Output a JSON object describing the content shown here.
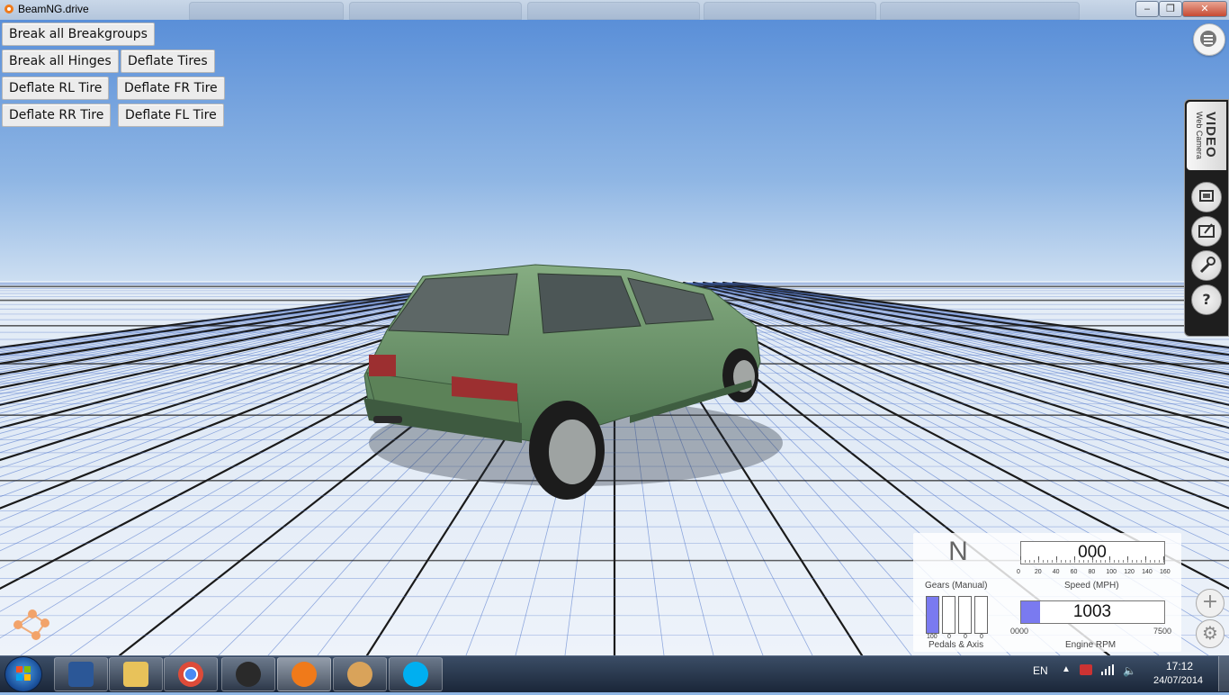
{
  "window": {
    "title": "BeamNG.drive",
    "controls": {
      "minimize": "‒",
      "restore": "❐",
      "close": "✕"
    }
  },
  "gamebuttons": {
    "break_all_breakgroups": "Break all Breakgroups",
    "break_all_hinges": "Break all Hinges",
    "deflate_tires": "Deflate Tires",
    "deflate_rl": "Deflate RL Tire",
    "deflate_fr": "Deflate FR Tire",
    "deflate_rr": "Deflate RR Tire",
    "deflate_fl": "Deflate FL Tire"
  },
  "video_panel": {
    "title": "VIDEO",
    "subtitle": "Web Camera",
    "icons": [
      "presentation-icon",
      "edit-icon",
      "wrench-icon",
      "help-icon"
    ],
    "help_glyph": "?"
  },
  "hud": {
    "gear": "N",
    "gears_label": "Gears (Manual)",
    "pedals_label": "Pedals & Axis",
    "pedal_values": [
      "100",
      "0",
      "0",
      "0"
    ],
    "pedal_fill": [
      1.0,
      0,
      0,
      0
    ],
    "speed": "000",
    "speed_label": "Speed (MPH)",
    "speed_ticks": [
      "0",
      "20",
      "40",
      "60",
      "80",
      "100",
      "120",
      "140",
      "160"
    ],
    "rpm": "1003",
    "rpm_label": "Engine RPM",
    "rpm_min": "0000",
    "rpm_max": "7500",
    "rpm_fraction": 0.134
  },
  "right_controls": {
    "add": "+",
    "settings": "⚙"
  },
  "colors": {
    "accent": "#7a7af0",
    "sky_top": "#5a8fd8",
    "car": "#6f9a6c"
  },
  "taskbar": {
    "apps": [
      "word-icon",
      "explorer-icon",
      "chrome-icon",
      "steam-icon",
      "beamng-icon",
      "paint-icon",
      "skype-icon"
    ],
    "language": "EN",
    "time": "17:12",
    "date": "24/07/2014"
  }
}
